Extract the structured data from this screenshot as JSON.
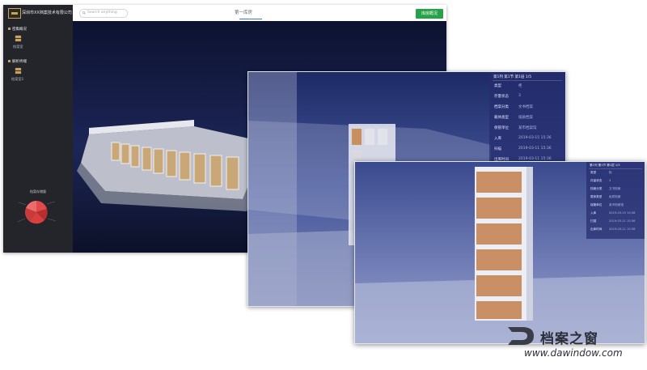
{
  "sidebar": {
    "company": "深圳市XX档案技术有限公司",
    "groups": [
      {
        "title": "密集概况",
        "item": "档案室"
      },
      {
        "title": "解析终端",
        "item": "档案室1"
      }
    ],
    "pie_title": "档案存储量"
  },
  "topbar": {
    "search_placeholder": "Search anything",
    "view_title": "第一库房",
    "overview_button": "库房概况"
  },
  "panel_mid": {
    "header": "第1列  第1节  第1层  1/5",
    "rows": [
      {
        "label": "类型",
        "value": "柜"
      },
      {
        "label": "存量状态",
        "value": "3"
      },
      {
        "label": "档案分类",
        "value": "文书档案"
      },
      {
        "label": "载体类型",
        "value": "纸质档案"
      },
      {
        "label": "保管单位",
        "value": "某市档案馆"
      },
      {
        "label": "入库",
        "value": "2019-03-15  15:36"
      },
      {
        "label": "扫描",
        "value": "2019-03-11  15:36"
      },
      {
        "label": "出库时间",
        "value": "2019-03-11  15:36"
      }
    ]
  },
  "panel_front": {
    "header": "第1列  第1节  第1层  1/5",
    "rows": [
      {
        "label": "类型",
        "value": "柜"
      },
      {
        "label": "存量状态",
        "value": "3"
      },
      {
        "label": "档案分类",
        "value": "文书档案"
      },
      {
        "label": "载体类型",
        "value": "纸质档案"
      },
      {
        "label": "保管单位",
        "value": "某市档案馆"
      },
      {
        "label": "入库",
        "value": "2019-03-15  15:36"
      },
      {
        "label": "扫描",
        "value": "2019-03-11  15:36"
      },
      {
        "label": "出库时间",
        "value": "2019-03-11  15:36"
      }
    ]
  },
  "watermark": {
    "brand": "档案之窗",
    "url": "www.dawindow.com"
  },
  "colors": {
    "accent_green": "#26a248",
    "sidebar": "#23252b",
    "scene_bg": "#0f1430",
    "gold": "#c9a35a",
    "pie_red": "#d93b3b"
  }
}
